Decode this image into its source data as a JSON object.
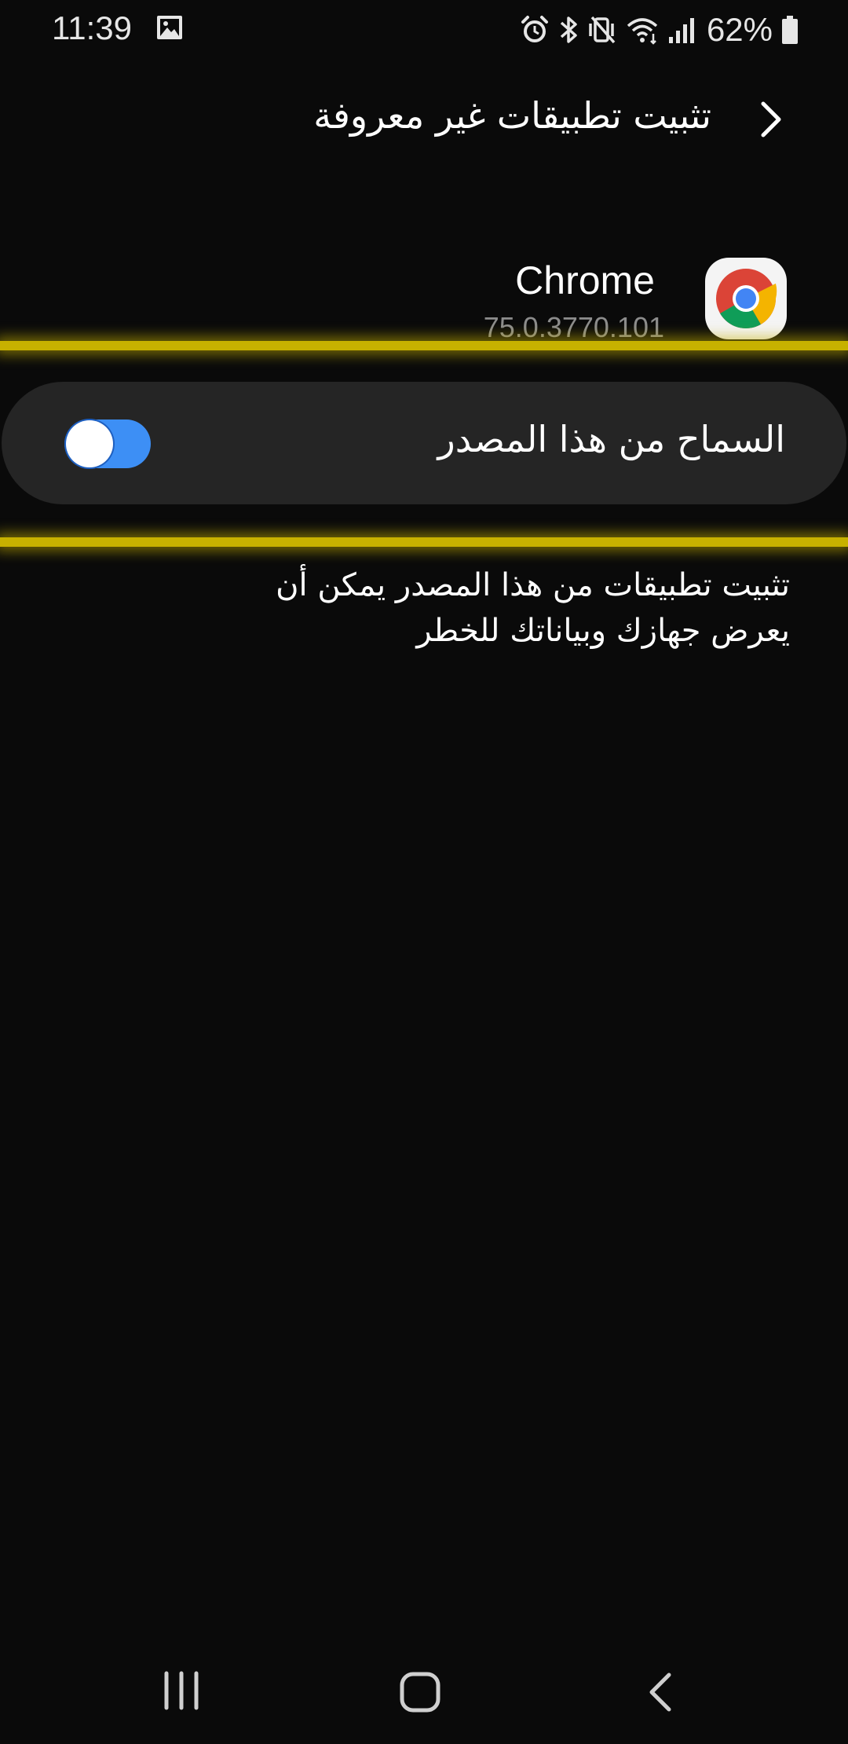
{
  "status_bar": {
    "time": "11:39",
    "left_icons": [
      "gallery-icon"
    ],
    "right_icons": [
      "alarm-icon",
      "bluetooth-icon",
      "mute-icon",
      "wifi-icon",
      "signal-icon",
      "battery-icon"
    ],
    "battery_percent": "62%"
  },
  "header": {
    "title": "تثبيت تطبيقات غير معروفة",
    "back_icon": "chevron-right-icon"
  },
  "app": {
    "name": "Chrome",
    "version": "75.0.3770.101",
    "icon": "chrome-icon"
  },
  "setting": {
    "label": "السماح من هذا المصدر",
    "enabled": true,
    "accent_color": "#3d8ff5"
  },
  "description": {
    "text": "تثبيت تطبيقات من هذا المصدر يمكن أن يعرض جهازك وبياناتك للخطر"
  },
  "highlight_color": "#c7b100",
  "nav_bar": {
    "icons": [
      "recent-apps-icon",
      "home-icon",
      "back-icon"
    ]
  }
}
